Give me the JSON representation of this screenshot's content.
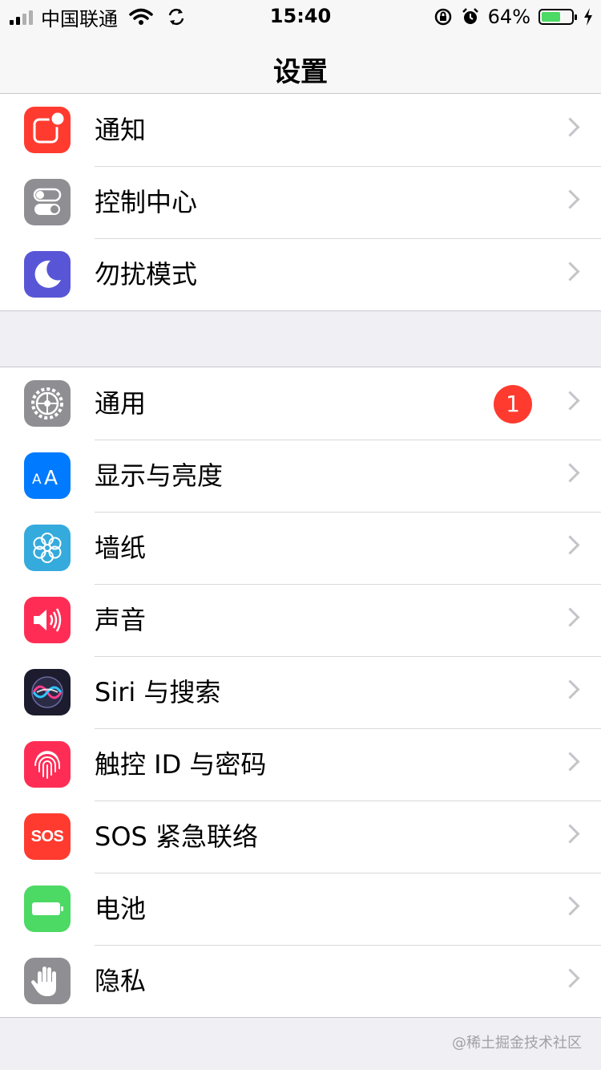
{
  "status_bar": {
    "carrier": "中国联通",
    "time": "15:40",
    "battery_percent": "64%",
    "battery_level": 0.64,
    "icons": [
      "signal-icon",
      "wifi-icon",
      "sync-icon",
      "rotation-lock-icon",
      "alarm-icon",
      "battery-icon",
      "charging-icon"
    ]
  },
  "nav": {
    "title": "设置"
  },
  "groups": [
    {
      "items": [
        {
          "label": "通知",
          "icon": "notifications-icon",
          "color": "#ff3b30"
        },
        {
          "label": "控制中心",
          "icon": "control-center-icon",
          "color": "#8e8e93"
        },
        {
          "label": "勿扰模式",
          "icon": "moon-icon",
          "color": "#5856d6"
        }
      ]
    },
    {
      "items": [
        {
          "label": "通用",
          "icon": "gear-icon",
          "color": "#8e8e93",
          "badge": "1"
        },
        {
          "label": "显示与亮度",
          "icon": "display-brightness-icon",
          "color": "#007aff"
        },
        {
          "label": "墙纸",
          "icon": "wallpaper-flower-icon",
          "color": "#35aadc"
        },
        {
          "label": "声音",
          "icon": "speaker-icon",
          "color": "#ff2d55"
        },
        {
          "label": "Siri 与搜索",
          "icon": "siri-icon",
          "color": "#1c1c2e"
        },
        {
          "label": "触控 ID 与密码",
          "icon": "fingerprint-icon",
          "color": "#ff2d55"
        },
        {
          "label": "SOS 紧急联络",
          "icon": "sos-icon",
          "color": "#ff3b30",
          "icon_text": "SOS"
        },
        {
          "label": "电池",
          "icon": "battery-settings-icon",
          "color": "#4cd964"
        },
        {
          "label": "隐私",
          "icon": "hand-icon",
          "color": "#8e8e93"
        }
      ]
    }
  ],
  "watermark": "@稀土掘金技术社区"
}
